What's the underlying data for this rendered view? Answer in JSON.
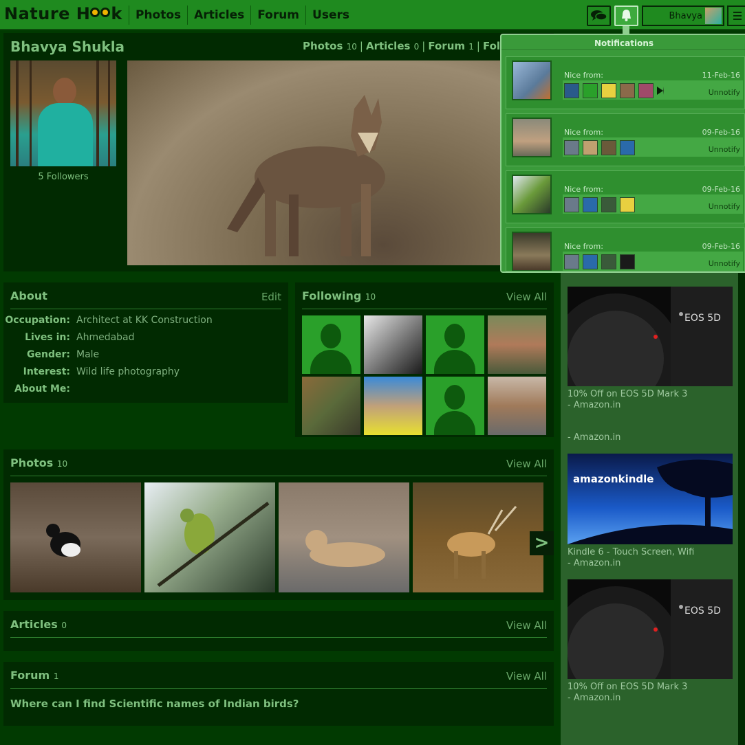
{
  "header": {
    "logo_left": "Nature H",
    "logo_right": "k",
    "nav": [
      "Photos",
      "Articles",
      "Forum",
      "Users"
    ],
    "username": "Bhavya"
  },
  "profile": {
    "name": "Bhavya Shukla",
    "links": [
      {
        "label": "Photos",
        "count": "10"
      },
      {
        "label": "Articles",
        "count": "0"
      },
      {
        "label": "Forum",
        "count": "1"
      },
      {
        "label": "Follo",
        "count": ""
      }
    ],
    "followers": "5 Followers"
  },
  "notifications": {
    "title": "Notifications",
    "items": [
      {
        "from": "Nice from:",
        "date": "11-Feb-16",
        "unnotify": "Unnotify",
        "likers": 5,
        "more": true
      },
      {
        "from": "Nice from:",
        "date": "09-Feb-16",
        "unnotify": "Unnotify",
        "likers": 4,
        "more": false
      },
      {
        "from": "Nice from:",
        "date": "09-Feb-16",
        "unnotify": "Unnotify",
        "likers": 4,
        "more": false
      },
      {
        "from": "Nice from:",
        "date": "09-Feb-16",
        "unnotify": "Unnotify",
        "likers": 4,
        "more": false
      }
    ]
  },
  "about": {
    "title": "About",
    "edit": "Edit",
    "rows": [
      {
        "k": "Occupation:",
        "v": "Architect at KK Construction"
      },
      {
        "k": "Lives in:",
        "v": "Ahmedabad"
      },
      {
        "k": "Gender:",
        "v": "Male"
      },
      {
        "k": "Interest:",
        "v": "Wild life photography"
      },
      {
        "k": "About Me:",
        "v": ""
      }
    ]
  },
  "following": {
    "title": "Following",
    "count": "10",
    "view_all": "View All"
  },
  "photos": {
    "title": "Photos",
    "count": "10",
    "view_all": "View All",
    "next": ">"
  },
  "articles": {
    "title": "Articles",
    "count": "0",
    "view_all": "View All"
  },
  "forum": {
    "title": "Forum",
    "count": "1",
    "view_all": "View All",
    "question": "Where can I find Scientific names of Indian birds?"
  },
  "ads": [
    {
      "line1": "10% Off on EOS 5D Mark 3",
      "line2": "- Amazon.in",
      "brand": "EOS 5D"
    },
    {
      "line1": "",
      "line2": "- Amazon.in",
      "brand": ""
    },
    {
      "line1": "Kindle 6 - Touch Screen, Wifi",
      "line2": "- Amazon.in",
      "brand": "amazonkindle"
    },
    {
      "line1": "10% Off on EOS 5D Mark 3",
      "line2": "- Amazon.in",
      "brand": "EOS 5D"
    }
  ],
  "colors": {
    "accent": "#1f8a1f",
    "panel": "#012a01",
    "background": "#013a01",
    "notif": "#3a9a3a"
  }
}
